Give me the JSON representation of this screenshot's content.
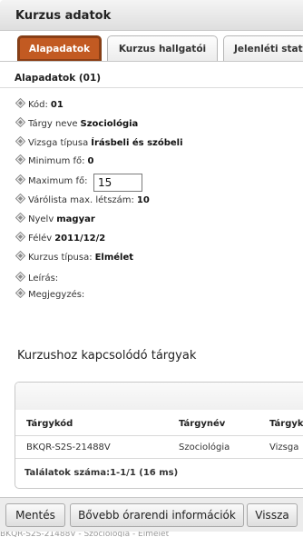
{
  "dialog": {
    "title": "Kurzus adatok"
  },
  "tabs": [
    {
      "label": "Alapadatok",
      "active": true
    },
    {
      "label": "Kurzus hallgatói",
      "active": false
    },
    {
      "label": "Jelenléti stat",
      "active": false
    }
  ],
  "section_title": "Alapadatok (01)",
  "fields": {
    "kod": {
      "label": "Kód:",
      "value": "01"
    },
    "targy_neve": {
      "label": "Tárgy neve",
      "value": "Szociológia"
    },
    "vizsga_tipusa": {
      "label": "Vizsga típusa",
      "value": "Írásbeli és szóbeli"
    },
    "minimum_fo": {
      "label": "Minimum fő:",
      "value": "0"
    },
    "maximum_fo": {
      "label": "Maximum fő:",
      "value": "15"
    },
    "varolista": {
      "label": "Várólista max. létszám:",
      "value": "10"
    },
    "nyelv": {
      "label": "Nyelv",
      "value": "magyar"
    },
    "felev": {
      "label": "Félév",
      "value": "2011/12/2"
    },
    "kurzus_tipusa": {
      "label": "Kurzus típusa:",
      "value": "Elmélet"
    },
    "leiras": {
      "label": "Leírás:",
      "value": ""
    },
    "megjegyzes": {
      "label": "Megjegyzés:",
      "value": ""
    }
  },
  "related": {
    "heading": "Kurzushoz kapcsolódó tárgyak",
    "columns": [
      "Tárgykód",
      "Tárgynév",
      "Tárgyk"
    ],
    "rows": [
      [
        "BKQR-S2S-21488V",
        "Szociológia",
        "Vizsga"
      ]
    ],
    "footer": "Találatok száma:1-1/1 (16 ms)"
  },
  "buttons": {
    "save": "Mentés",
    "more_info": "Bővebb órarendi információk",
    "back": "Vissza"
  },
  "status_strip": "BKQR-S2S-21488V - Szociológia - Elmélet",
  "colors": {
    "active_tab": "#c25a22",
    "bullet": "#8a8a8a"
  }
}
